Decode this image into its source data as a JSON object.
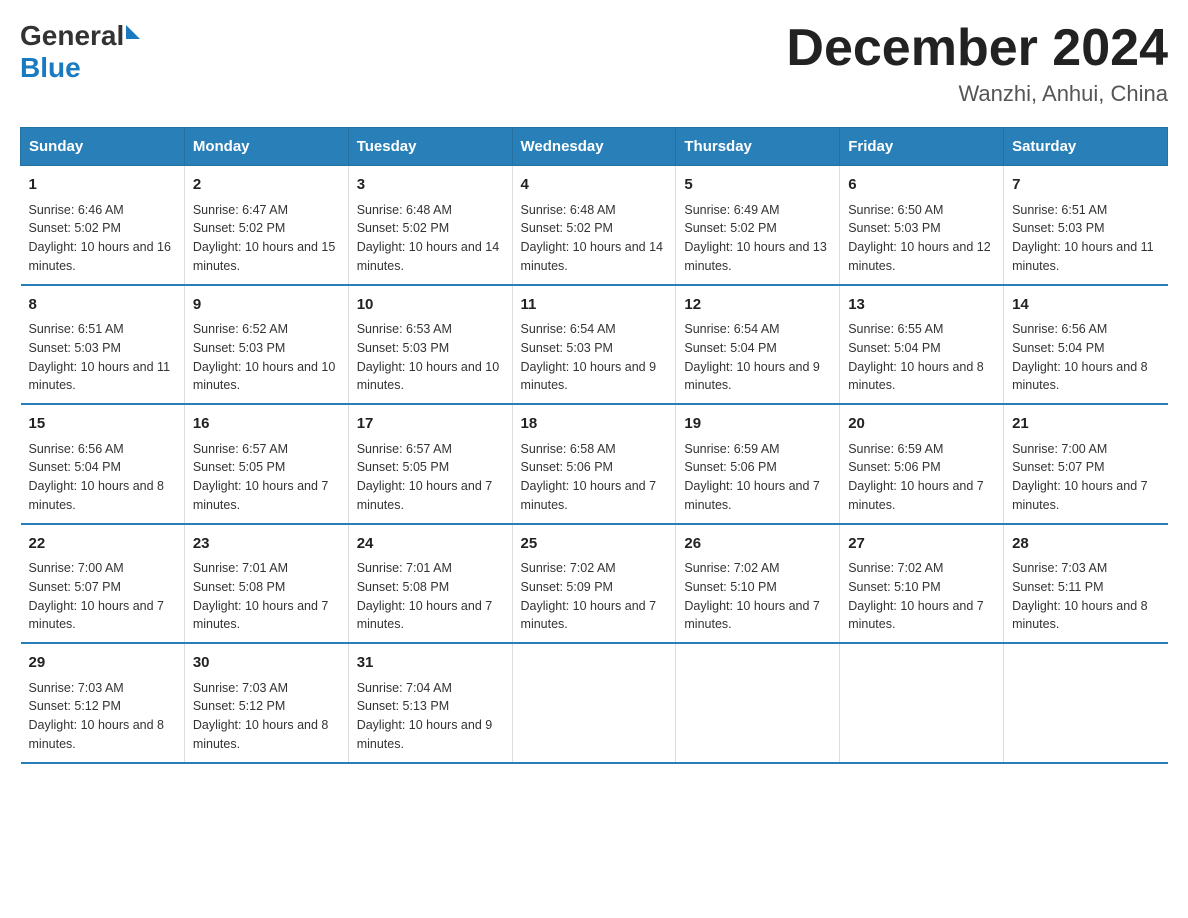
{
  "header": {
    "logo_general": "General",
    "logo_blue": "Blue",
    "month_title": "December 2024",
    "location": "Wanzhi, Anhui, China"
  },
  "weekdays": [
    "Sunday",
    "Monday",
    "Tuesday",
    "Wednesday",
    "Thursday",
    "Friday",
    "Saturday"
  ],
  "weeks": [
    [
      {
        "day": "1",
        "sunrise": "6:46 AM",
        "sunset": "5:02 PM",
        "daylight": "10 hours and 16 minutes."
      },
      {
        "day": "2",
        "sunrise": "6:47 AM",
        "sunset": "5:02 PM",
        "daylight": "10 hours and 15 minutes."
      },
      {
        "day": "3",
        "sunrise": "6:48 AM",
        "sunset": "5:02 PM",
        "daylight": "10 hours and 14 minutes."
      },
      {
        "day": "4",
        "sunrise": "6:48 AM",
        "sunset": "5:02 PM",
        "daylight": "10 hours and 14 minutes."
      },
      {
        "day": "5",
        "sunrise": "6:49 AM",
        "sunset": "5:02 PM",
        "daylight": "10 hours and 13 minutes."
      },
      {
        "day": "6",
        "sunrise": "6:50 AM",
        "sunset": "5:03 PM",
        "daylight": "10 hours and 12 minutes."
      },
      {
        "day": "7",
        "sunrise": "6:51 AM",
        "sunset": "5:03 PM",
        "daylight": "10 hours and 11 minutes."
      }
    ],
    [
      {
        "day": "8",
        "sunrise": "6:51 AM",
        "sunset": "5:03 PM",
        "daylight": "10 hours and 11 minutes."
      },
      {
        "day": "9",
        "sunrise": "6:52 AM",
        "sunset": "5:03 PM",
        "daylight": "10 hours and 10 minutes."
      },
      {
        "day": "10",
        "sunrise": "6:53 AM",
        "sunset": "5:03 PM",
        "daylight": "10 hours and 10 minutes."
      },
      {
        "day": "11",
        "sunrise": "6:54 AM",
        "sunset": "5:03 PM",
        "daylight": "10 hours and 9 minutes."
      },
      {
        "day": "12",
        "sunrise": "6:54 AM",
        "sunset": "5:04 PM",
        "daylight": "10 hours and 9 minutes."
      },
      {
        "day": "13",
        "sunrise": "6:55 AM",
        "sunset": "5:04 PM",
        "daylight": "10 hours and 8 minutes."
      },
      {
        "day": "14",
        "sunrise": "6:56 AM",
        "sunset": "5:04 PM",
        "daylight": "10 hours and 8 minutes."
      }
    ],
    [
      {
        "day": "15",
        "sunrise": "6:56 AM",
        "sunset": "5:04 PM",
        "daylight": "10 hours and 8 minutes."
      },
      {
        "day": "16",
        "sunrise": "6:57 AM",
        "sunset": "5:05 PM",
        "daylight": "10 hours and 7 minutes."
      },
      {
        "day": "17",
        "sunrise": "6:57 AM",
        "sunset": "5:05 PM",
        "daylight": "10 hours and 7 minutes."
      },
      {
        "day": "18",
        "sunrise": "6:58 AM",
        "sunset": "5:06 PM",
        "daylight": "10 hours and 7 minutes."
      },
      {
        "day": "19",
        "sunrise": "6:59 AM",
        "sunset": "5:06 PM",
        "daylight": "10 hours and 7 minutes."
      },
      {
        "day": "20",
        "sunrise": "6:59 AM",
        "sunset": "5:06 PM",
        "daylight": "10 hours and 7 minutes."
      },
      {
        "day": "21",
        "sunrise": "7:00 AM",
        "sunset": "5:07 PM",
        "daylight": "10 hours and 7 minutes."
      }
    ],
    [
      {
        "day": "22",
        "sunrise": "7:00 AM",
        "sunset": "5:07 PM",
        "daylight": "10 hours and 7 minutes."
      },
      {
        "day": "23",
        "sunrise": "7:01 AM",
        "sunset": "5:08 PM",
        "daylight": "10 hours and 7 minutes."
      },
      {
        "day": "24",
        "sunrise": "7:01 AM",
        "sunset": "5:08 PM",
        "daylight": "10 hours and 7 minutes."
      },
      {
        "day": "25",
        "sunrise": "7:02 AM",
        "sunset": "5:09 PM",
        "daylight": "10 hours and 7 minutes."
      },
      {
        "day": "26",
        "sunrise": "7:02 AM",
        "sunset": "5:10 PM",
        "daylight": "10 hours and 7 minutes."
      },
      {
        "day": "27",
        "sunrise": "7:02 AM",
        "sunset": "5:10 PM",
        "daylight": "10 hours and 7 minutes."
      },
      {
        "day": "28",
        "sunrise": "7:03 AM",
        "sunset": "5:11 PM",
        "daylight": "10 hours and 8 minutes."
      }
    ],
    [
      {
        "day": "29",
        "sunrise": "7:03 AM",
        "sunset": "5:12 PM",
        "daylight": "10 hours and 8 minutes."
      },
      {
        "day": "30",
        "sunrise": "7:03 AM",
        "sunset": "5:12 PM",
        "daylight": "10 hours and 8 minutes."
      },
      {
        "day": "31",
        "sunrise": "7:04 AM",
        "sunset": "5:13 PM",
        "daylight": "10 hours and 9 minutes."
      },
      null,
      null,
      null,
      null
    ]
  ],
  "labels": {
    "sunrise": "Sunrise:",
    "sunset": "Sunset:",
    "daylight": "Daylight:"
  }
}
